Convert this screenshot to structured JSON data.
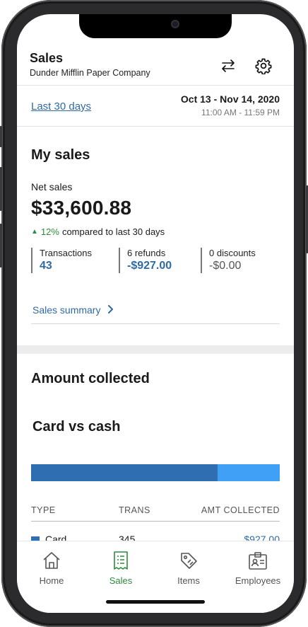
{
  "header": {
    "title": "Sales",
    "subtitle": "Dunder Mifflin Paper Company",
    "swap_icon": "swap-arrows-icon",
    "settings_icon": "gear-icon"
  },
  "date_range": {
    "link": "Last 30 days",
    "dates": "Oct 13 - Nov 14, 2020",
    "times": "11:00 AM - 11:59 PM"
  },
  "my_sales": {
    "heading": "My sales",
    "net_label": "Net sales",
    "net_value": "$33,600.88",
    "change_pct": "12%",
    "change_text": "compared to last 30 days",
    "stats": [
      {
        "label": "Transactions",
        "value": "43"
      },
      {
        "label": "6 refunds",
        "value": "-$927.00"
      },
      {
        "label": "0 discounts",
        "value": "-$0.00"
      }
    ],
    "summary_link": "Sales summary"
  },
  "amount_collected": {
    "heading": "Amount collected",
    "subheading": "Card vs cash",
    "split": {
      "card_fraction": 0.75,
      "card_color": "#2f6eb0",
      "cash_color": "#3fa0f5"
    },
    "table": {
      "headers": [
        "TYPE",
        "TRANS",
        "AMT COLLECTED"
      ],
      "rows": [
        {
          "type": "Card",
          "trans": "345",
          "amount": "$927.00"
        }
      ]
    }
  },
  "nav": {
    "items": [
      {
        "label": "Home",
        "icon": "home-icon"
      },
      {
        "label": "Sales",
        "icon": "receipt-icon"
      },
      {
        "label": "Items",
        "icon": "tag-icon"
      },
      {
        "label": "Employees",
        "icon": "id-badge-icon"
      }
    ],
    "active_index": 1,
    "active_color": "#2e8b3e"
  },
  "accent": {
    "link": "#2f6aa5",
    "positive": "#2e8b3e"
  }
}
